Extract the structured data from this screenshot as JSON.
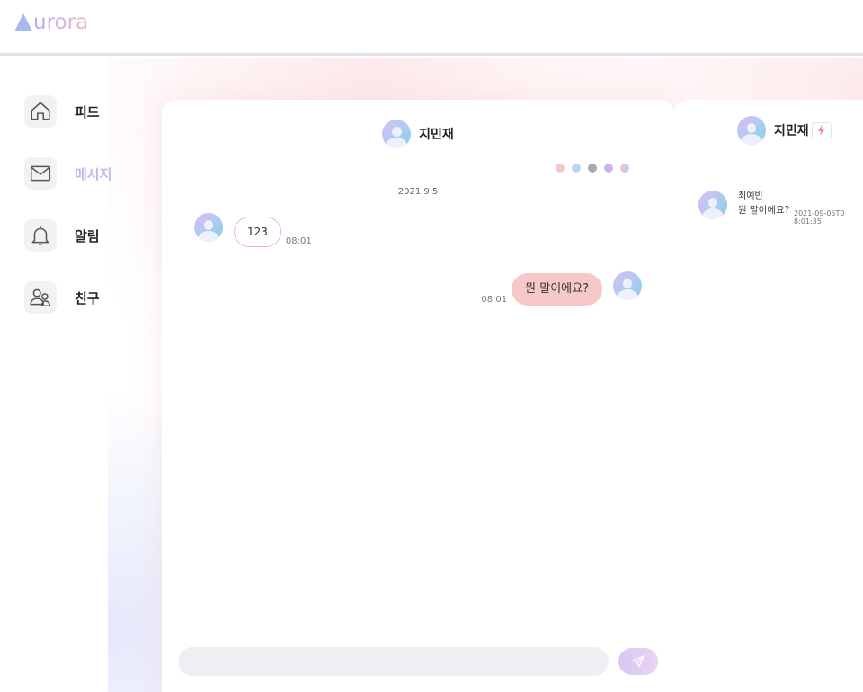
{
  "app": {
    "logo_a": "A",
    "logo_rest": "urora"
  },
  "colors": {
    "accent_purple": "#c6b4ee",
    "bubble_out": "#f7c8c8",
    "bubble_in_border": "#f2b6bf",
    "dots": [
      "#f6c7c8",
      "#b9d4f4",
      "#a9a9ab",
      "#c9b3f0",
      "#d6c0ee"
    ]
  },
  "sidebar": {
    "items": [
      {
        "label": "피드",
        "icon": "home-icon"
      },
      {
        "label": "메시지",
        "icon": "mail-icon",
        "active": true
      },
      {
        "label": "알림",
        "icon": "bell-icon"
      },
      {
        "label": "친구",
        "icon": "friends-icon"
      }
    ]
  },
  "chat": {
    "partner_name": "지민재",
    "date_separator": "2021 9 5",
    "messages": [
      {
        "direction": "in",
        "text": "123",
        "time": "08:01"
      },
      {
        "direction": "out",
        "text": "뭔 말이에요?",
        "time": "08:01"
      }
    ],
    "input_placeholder": "",
    "send_icon": "send-icon"
  },
  "rooms_panel": {
    "user_name": "지민재",
    "badge_icon": "bolt-icon",
    "rooms": [
      {
        "name": "최예빈",
        "last_message": "뭔 말이에요?",
        "time": "2021-09-05T08:01:35"
      }
    ]
  }
}
